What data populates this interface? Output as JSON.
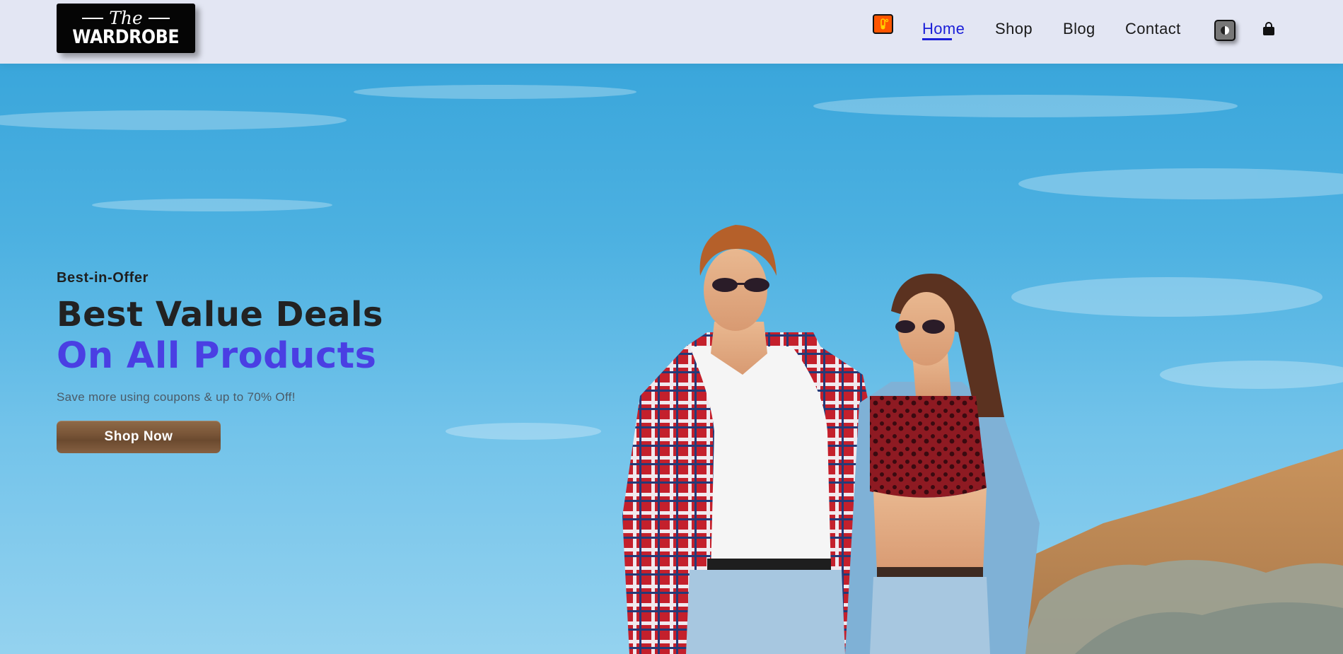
{
  "brand": {
    "logo_line1": "The",
    "logo_line2": "WARDROBE"
  },
  "nav": {
    "items": [
      {
        "label": "Home",
        "active": true
      },
      {
        "label": "Shop",
        "active": false
      },
      {
        "label": "Blog",
        "active": false
      },
      {
        "label": "Contact",
        "active": false
      }
    ],
    "icons": {
      "weather": "weather-icon",
      "theme": "theme-toggle-icon",
      "cart": "shopping-bag-icon"
    }
  },
  "hero": {
    "kicker": "Best-in-Offer",
    "headline": "Best Value Deals",
    "headline_accent": "On All Products",
    "subline": "Save more using coupons & up to 70% Off!",
    "cta_label": "Shop Now"
  },
  "colors": {
    "header_bg": "#e3e6f3",
    "nav_active": "#1b1fd8",
    "headline_accent": "#4a3fe3",
    "weather_btn": "#ff5500",
    "cta_bg": "#7a5638"
  }
}
